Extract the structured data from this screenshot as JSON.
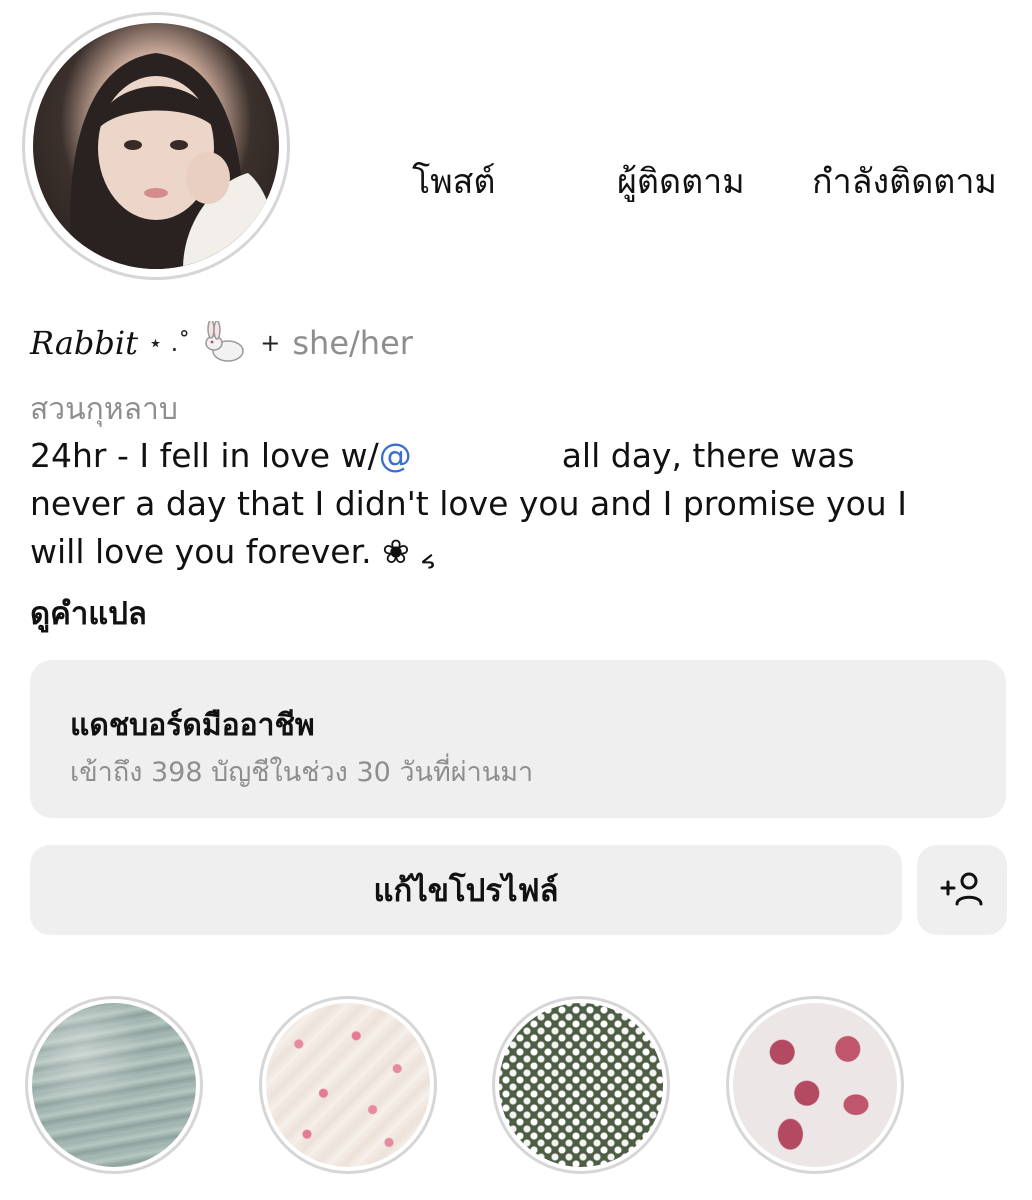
{
  "profile": {
    "display_name": "Rabbit",
    "name_decoration": "⋆ .˚",
    "name_emoji": "rabbit-emoji",
    "pronoun_separator": "+",
    "pronouns": "she/her",
    "category": "สวนกุหลาบ"
  },
  "stats": {
    "posts_label": "โพสต์",
    "followers_label": "ผู้ติดตาม",
    "following_label": "กำลังติดตาม"
  },
  "bio": {
    "line1_before": "24hr - I fell in love w/",
    "mention": "@",
    "line1_after": "all day, there was",
    "line2": "never a day that I didn't love you and I promise you I",
    "line3": "will love you forever. ❀ ៹"
  },
  "see_translation": "ดูคำแปล",
  "dashboard": {
    "title": "แดชบอร์ดมืออาชีพ",
    "subtitle": "เข้าถึง 398 บัญชีในช่วง 30 วันที่ผ่านมา"
  },
  "actions": {
    "edit_profile": "แก้ไขโปรไฟล์",
    "add_person_icon": "add-person-icon"
  },
  "highlights": [
    {
      "image": "sea-water"
    },
    {
      "image": "floral-fabric"
    },
    {
      "image": "white-flowers"
    },
    {
      "image": "lipstick-kisses"
    }
  ],
  "colors": {
    "muted_text": "#8e8e8e",
    "mention": "#3a6fd0",
    "button_bg": "#efefef",
    "ring": "#d6d6d6"
  }
}
